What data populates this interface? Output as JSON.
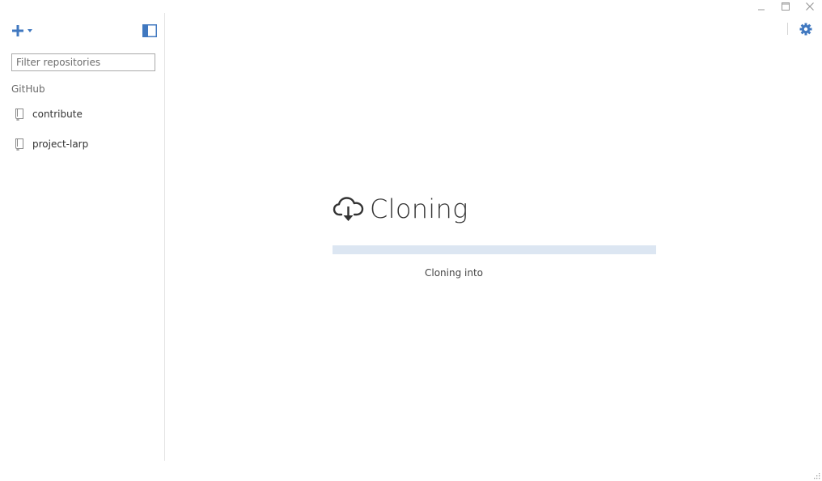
{
  "window": {
    "controls": {
      "minimize_icon": "minimize-icon",
      "maximize_icon": "maximize-icon",
      "close_icon": "close-icon"
    }
  },
  "sidebar": {
    "add_icon": "plus-icon",
    "add_dropdown_icon": "caret-down-icon",
    "toggle_icon": "sidebar-toggle-icon",
    "filter": {
      "placeholder": "Filter repositories",
      "value": ""
    },
    "group_label": "GitHub",
    "repositories": [
      {
        "name": "contribute",
        "icon": "repo-icon"
      },
      {
        "name": "project-larp",
        "icon": "repo-icon"
      }
    ]
  },
  "toolbar": {
    "settings_icon": "gear-icon"
  },
  "clone": {
    "icon": "cloud-download-icon",
    "title": "Cloning",
    "progress": 0,
    "status": "Cloning into"
  },
  "colors": {
    "accent": "#4078c0",
    "progress_track": "#dce6f2",
    "text": "#333333",
    "muted": "#6a6a6a",
    "border": "#e3e3e3"
  }
}
